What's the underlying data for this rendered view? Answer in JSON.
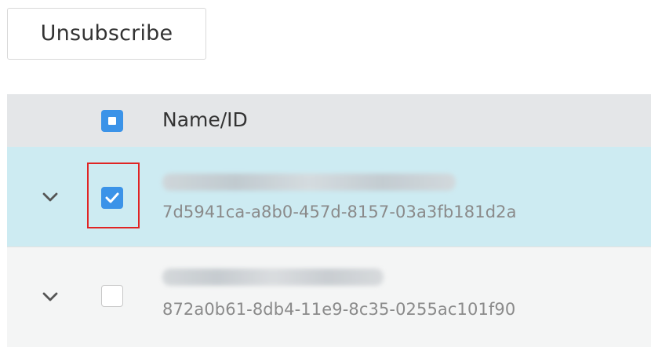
{
  "toolbar": {
    "unsubscribe_label": "Unsubscribe"
  },
  "table": {
    "header": {
      "name_id_label": "Name/ID",
      "select_all_state": "indeterminate"
    },
    "rows": [
      {
        "name": "[redacted]",
        "id": "7d5941ca-a8b0-457d-8157-03a3fb181d2a",
        "selected": true,
        "highlighted": true
      },
      {
        "name": "[redacted]",
        "id": "872a0b61-8db4-11e9-8c35-0255ac101f90",
        "selected": false,
        "highlighted": false
      }
    ]
  },
  "colors": {
    "accent_blue": "#3b93e8",
    "selected_row_bg": "#cdebf2",
    "header_bg": "#e4e6e8",
    "highlight_red": "#e02424"
  },
  "icons": {
    "expand": "chevron-down-icon",
    "check": "checkmark-icon"
  }
}
